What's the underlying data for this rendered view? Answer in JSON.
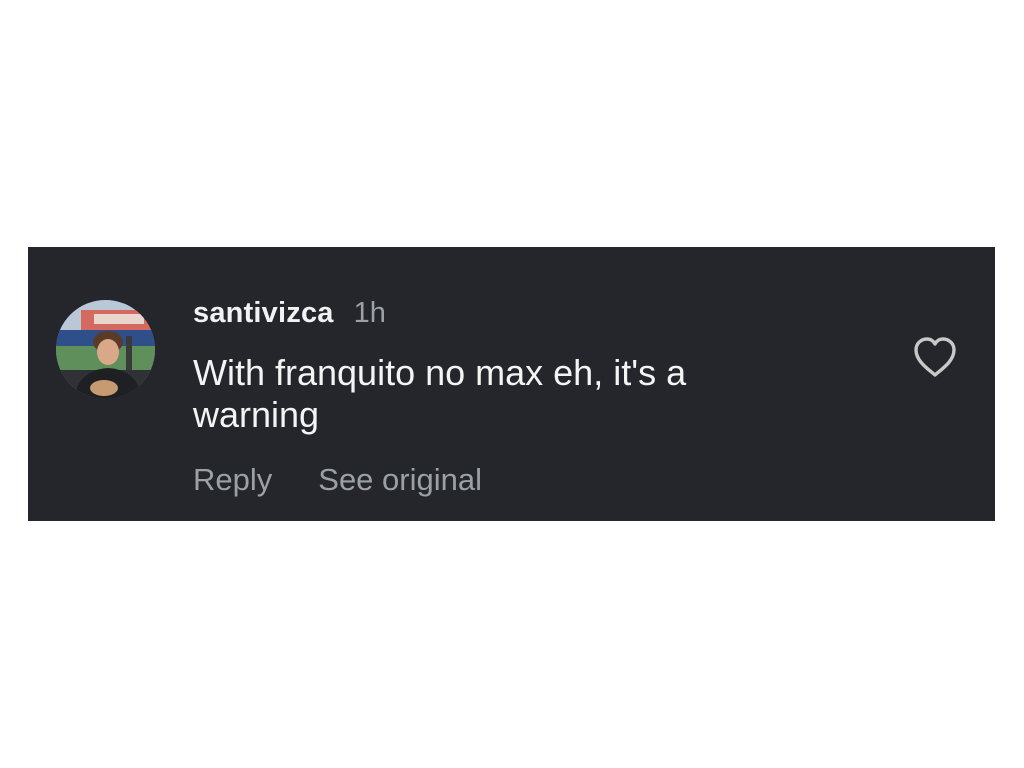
{
  "comment": {
    "username": "santivizca",
    "timestamp": "1h",
    "text_line_1": "With franquito no max eh, it's a",
    "text_line_2": "warning",
    "avatar_icon": "profile-photo-icon",
    "like_icon": "heart-outline-icon"
  },
  "actions": {
    "reply_label": "Reply",
    "see_original_label": "See original"
  },
  "colors": {
    "card_background": "#25262b",
    "username_text": "#f2f2f2",
    "secondary_text": "#9aa0a6",
    "heart_outline": "#c8c8c8"
  }
}
